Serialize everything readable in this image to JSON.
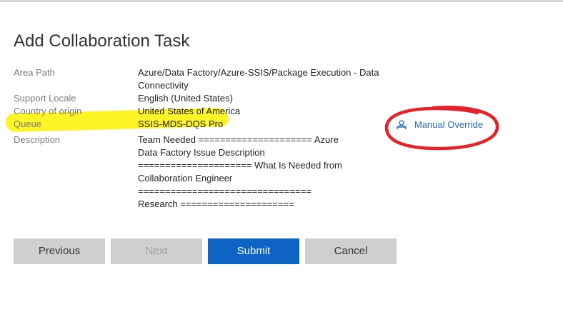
{
  "page": {
    "title": "Add Collaboration Task"
  },
  "fields": {
    "area_path": {
      "label": "Area Path",
      "value_line1": "Azure/Data Factory/Azure-SSIS/Package Execution - Data",
      "value_line2": "Connectivity"
    },
    "support_locale": {
      "label": "Support Locale",
      "value": "English (United States)"
    },
    "country": {
      "label": "Country of origin",
      "value": "United States of America"
    },
    "queue": {
      "label": "Queue",
      "value": "SSIS-MDS-DQS Pro"
    },
    "description": {
      "label": "Description",
      "lines": [
        "Team Needed ===================== Azure",
        "Data Factory Issue Description",
        "===================== What Is Needed from",
        "Collaboration Engineer",
        "================================",
        "Research ====================="
      ]
    }
  },
  "manual_override": {
    "label": "Manual Override",
    "icon": "user-gear-icon"
  },
  "buttons": {
    "previous": "Previous",
    "next": "Next",
    "submit": "Submit",
    "cancel": "Cancel"
  },
  "colors": {
    "accent": "#0e64c4",
    "link": "#2b6ab7",
    "highlight": "#fff200",
    "annotation": "#e4232b",
    "button_gray": "#cfcfcf"
  }
}
